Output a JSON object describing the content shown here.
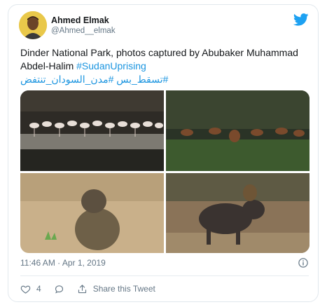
{
  "author": {
    "name": "Ahmed Elmak",
    "handle": "@Ahmed__elmak",
    "avatar": "avatar-photo"
  },
  "tweet": {
    "text_line1": "Dinder National Park, photos captured by Abubaker Muhammad Abdel-Halim",
    "hashtag_en": "#SudanUprising",
    "hashtag_ar": "#تسقط_بس #مدن_السودان_تنتفض",
    "hashtag_color": "#1b95e0"
  },
  "photos": [
    {
      "name": "photo-flamingos",
      "description_icon": "flamingos-image"
    },
    {
      "name": "photo-antelopes",
      "description_icon": "antelopes-image"
    },
    {
      "name": "photo-baboon",
      "description_icon": "baboon-image"
    },
    {
      "name": "photo-warthog",
      "description_icon": "warthog-image"
    }
  ],
  "meta": {
    "timestamp": "11:46 AM · Apr 1, 2019"
  },
  "actions": {
    "like_count": "4",
    "share_label": "Share this Tweet"
  },
  "colors": {
    "twitter_blue": "#1da1f2",
    "secondary_text": "#657786",
    "border": "#e1e8ed"
  }
}
